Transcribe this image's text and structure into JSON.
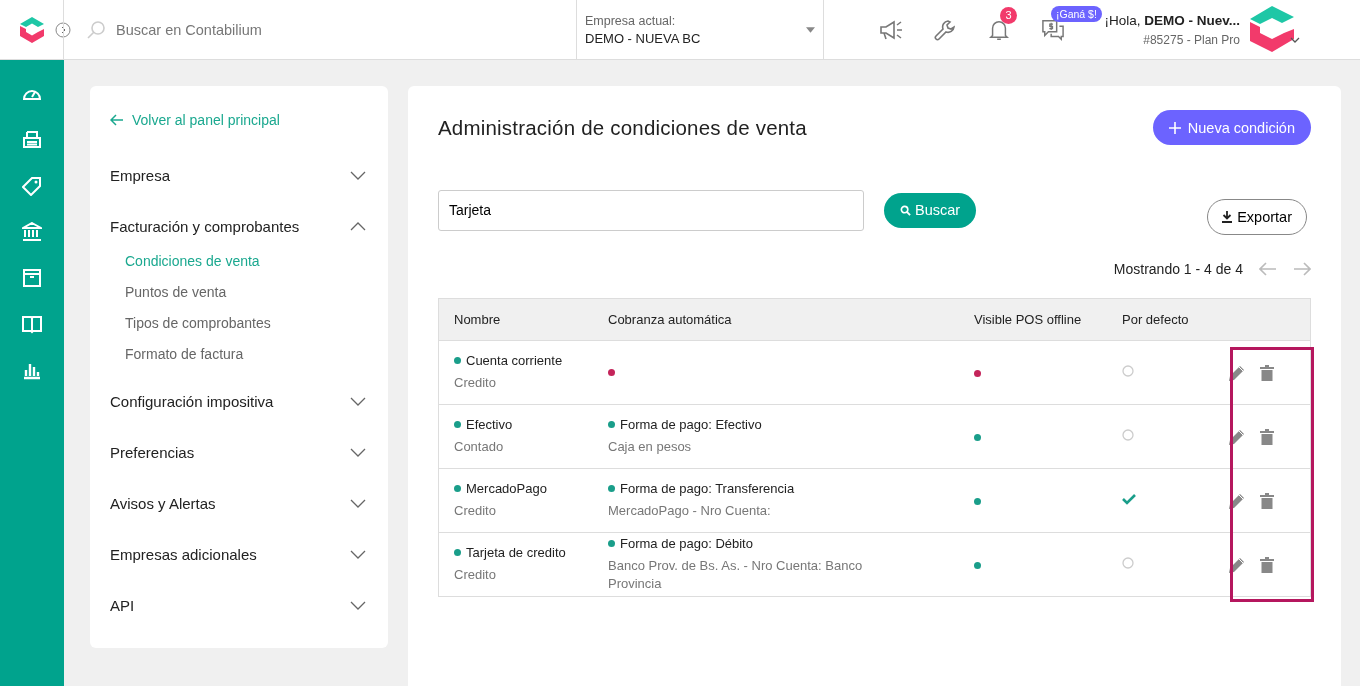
{
  "topbar": {
    "search_placeholder": "Buscar en Contabilium",
    "company_label": "Empresa actual:",
    "company": "DEMO - NUEVA BC",
    "notifications": "3",
    "promo_badge": "¡Ganá $!",
    "greeting": "¡Hola, **DEMO - Nuev...**",
    "account": "#85275 - Plan Pro"
  },
  "back_link": "Volver al panel principal",
  "menu": [
    {
      "label": "Empresa",
      "expanded": false
    },
    {
      "label": "Facturación y comprobantes",
      "expanded": true,
      "children": [
        {
          "label": "Condiciones de venta",
          "selected": true
        },
        {
          "label": "Puntos de venta",
          "selected": false
        },
        {
          "label": "Tipos de comprobantes",
          "selected": false
        },
        {
          "label": "Formato de factura",
          "selected": false
        }
      ]
    },
    {
      "label": "Configuración impositiva",
      "expanded": false
    },
    {
      "label": "Preferencias",
      "expanded": false
    },
    {
      "label": "Avisos y Alertas",
      "expanded": false
    },
    {
      "label": "Empresas adicionales",
      "expanded": false
    },
    {
      "label": "API",
      "expanded": false
    }
  ],
  "page_title": "Administración de condiciones de venta",
  "new_button": "Nueva condición",
  "search": {
    "value": "Tarjeta"
  },
  "search_button": "Buscar",
  "export_button": "Exportar",
  "pagination": "Mostrando 1 - 4 de 4",
  "table": {
    "columns": [
      "Nombre",
      "Cobranza automática",
      "Visible POS offline",
      "Por defecto"
    ],
    "rows": [
      {
        "name": "Cuenta corriente",
        "type": "Credito",
        "auto_collect": false,
        "visible_pos": false,
        "default": false
      },
      {
        "name": "Efectivo",
        "type": "Contado",
        "auto_collect": true,
        "collect_label": "Forma de pago: Efectivo",
        "collect_detail": "Caja en pesos",
        "visible_pos": true,
        "default": false
      },
      {
        "name": "MercadoPago",
        "type": "Credito",
        "auto_collect": true,
        "collect_label": "Forma de pago: Transferencia",
        "collect_detail": "MercadoPago - Nro Cuenta:",
        "visible_pos": true,
        "default": true
      },
      {
        "name": "Tarjeta de credito",
        "type": "Credito",
        "auto_collect": true,
        "collect_label": "Forma de pago: Débito",
        "collect_detail": "Banco Prov. de Bs. As. - Nro Cuenta: Banco Provincia",
        "visible_pos": true,
        "default": false
      }
    ]
  },
  "actions_highlighted": true
}
